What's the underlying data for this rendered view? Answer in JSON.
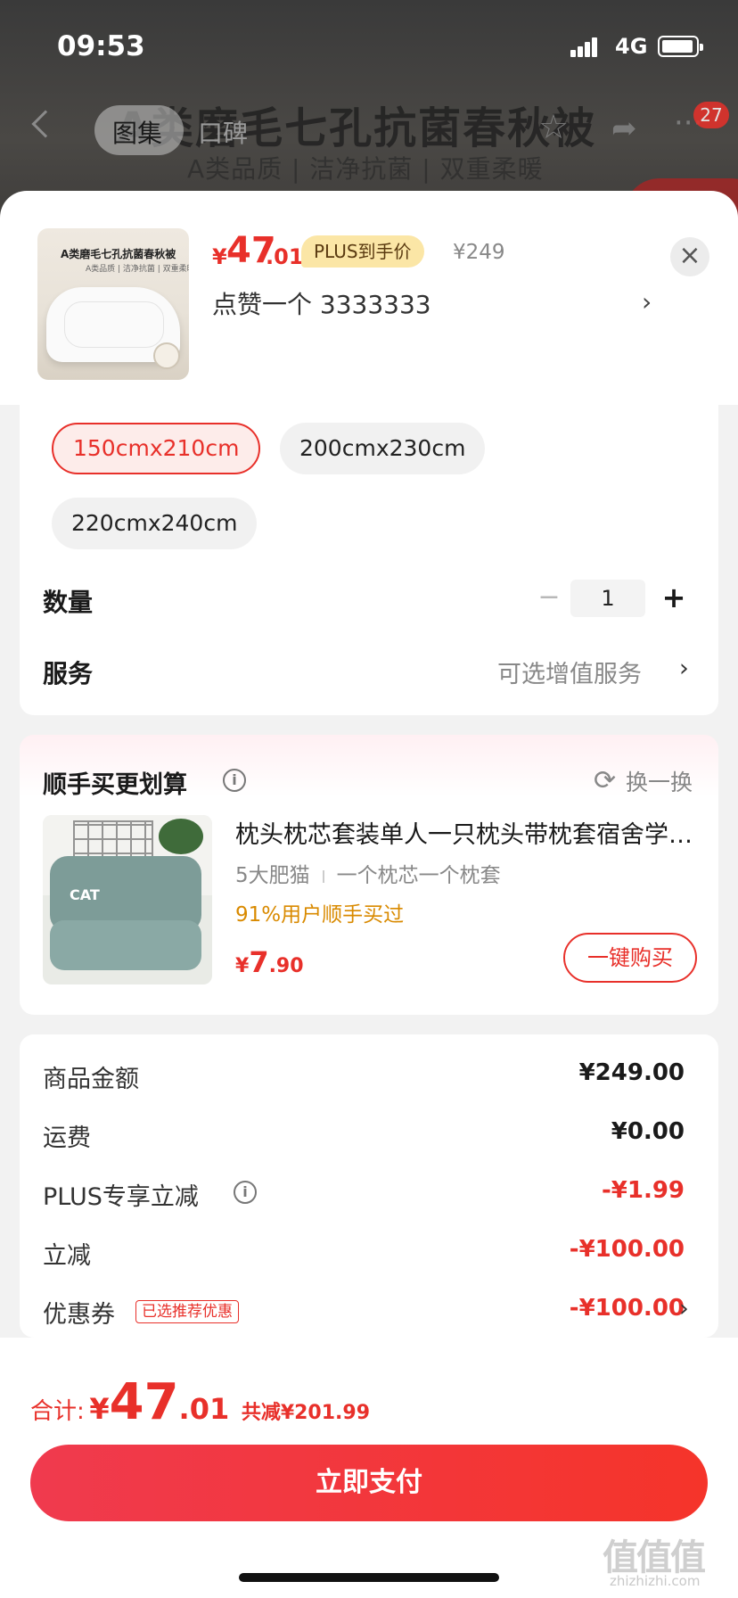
{
  "status_bar": {
    "time": "09:53",
    "network": "4G"
  },
  "background_page": {
    "title": "A类磨毛七孔抗菌春秋被",
    "subtitle": "A类品质 | 洁净抗菌 | 双重柔暖",
    "tabs": [
      "图集",
      "口碑"
    ],
    "cart_badge": "27"
  },
  "product": {
    "thumb_title": "A类磨毛七孔抗菌春秋被",
    "thumb_subtitle": "A类品质 | 洁净抗菌 | 双重柔暖",
    "price_currency": "¥",
    "price_int": "47",
    "price_dec": ".01",
    "plus_tag": "PLUS到手价",
    "original_price": "¥249",
    "like_text": "点赞一个  3333333"
  },
  "spec": {
    "sizes": [
      {
        "label": "150cmx210cm",
        "selected": true
      },
      {
        "label": "200cmx230cm",
        "selected": false
      },
      {
        "label": "220cmx240cm",
        "selected": false
      }
    ],
    "quantity_label": "数量",
    "quantity_value": "1",
    "service_label": "服务",
    "service_value": "可选增值服务"
  },
  "bundle": {
    "title": "顺手买更划算",
    "refresh_label": "换一换",
    "item_name": "枕头枕芯套装单人一只枕头带枕套宿舍学生枕",
    "shop": "5大肥猫",
    "spec": "一个枕芯一个枕套",
    "rate": "91%用户顺手买过",
    "price_currency": "¥",
    "price_int": "7",
    "price_dec": ".90",
    "buy_label": "一键购买",
    "image_text": "CAT"
  },
  "price_breakdown": [
    {
      "label": "商品金额",
      "value": "¥249.00",
      "red": false
    },
    {
      "label": "运费",
      "value": "¥0.00",
      "red": false
    },
    {
      "label": "PLUS专享立减",
      "value": "-¥1.99",
      "red": true,
      "info": true
    },
    {
      "label": "立减",
      "value": "-¥100.00",
      "red": true
    },
    {
      "label": "优惠券",
      "value": "-¥100.00",
      "red": true,
      "tag": "已选推荐优惠",
      "chevron": true
    }
  ],
  "footer": {
    "total_label": "合计:",
    "total_currency": "¥",
    "total_int": "47",
    "total_dec": ".01",
    "saved": "共减¥201.99",
    "pay_label": "立即支付",
    "watermark": "值值值",
    "watermark_sub": "zhizhizhi.com"
  },
  "colors": {
    "accent": "#e8302a",
    "plus_tag_bg": "#fbe6a6",
    "rate": "#d98a00"
  }
}
